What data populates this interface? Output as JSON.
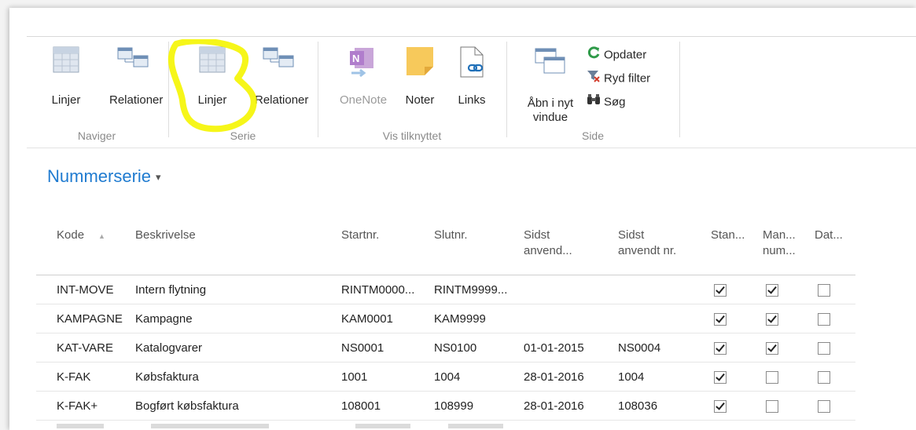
{
  "ribbon": {
    "groups": [
      {
        "label": "Naviger",
        "buttons": [
          "Linjer",
          "Relationer"
        ]
      },
      {
        "label": "Serie",
        "buttons": [
          "Linjer",
          "Relationer"
        ]
      },
      {
        "label": "Vis tilknyttet",
        "buttons": [
          "OneNote",
          "Noter",
          "Links"
        ]
      },
      {
        "label": "Side",
        "buttons": [
          "Åbn i nyt",
          "vindue"
        ],
        "small": [
          "Opdater",
          "Ryd filter",
          "Søg"
        ]
      }
    ]
  },
  "page": {
    "title": "Nummerserie"
  },
  "table": {
    "headers": [
      "Kode",
      "Beskrivelse",
      "Startnr.",
      "Slutnr.",
      "Sidst",
      "anvend...",
      "Sidst",
      "anvendt nr.",
      "Stan...",
      "Man...",
      "num...",
      "Dat..."
    ],
    "rows": [
      {
        "kode": "INT-MOVE",
        "beskrivelse": "Intern flytning",
        "start": "RINTM0000...",
        "slut": "RINTM9999...",
        "sidst_dato": "",
        "sidst_nr": "",
        "stan": true,
        "man": true,
        "dat": false
      },
      {
        "kode": "KAMPAGNE",
        "beskrivelse": "Kampagne",
        "start": "KAM0001",
        "slut": "KAM9999",
        "sidst_dato": "",
        "sidst_nr": "",
        "stan": true,
        "man": true,
        "dat": false
      },
      {
        "kode": "KAT-VARE",
        "beskrivelse": "Katalogvarer",
        "start": "NS0001",
        "slut": "NS0100",
        "sidst_dato": "01-01-2015",
        "sidst_nr": "NS0004",
        "stan": true,
        "man": true,
        "dat": false
      },
      {
        "kode": "K-FAK",
        "beskrivelse": "Købsfaktura",
        "start": "1001",
        "slut": "1004",
        "sidst_dato": "28-01-2016",
        "sidst_nr": "1004",
        "stan": true,
        "man": false,
        "dat": false
      },
      {
        "kode": "K-FAK+",
        "beskrivelse": "Bogført købsfaktura",
        "start": "108001",
        "slut": "108999",
        "sidst_dato": "28-01-2016",
        "sidst_nr": "108036",
        "stan": true,
        "man": false,
        "dat": false
      }
    ]
  },
  "colors": {
    "accent": "#1f7bd0",
    "highlight": "#f5f500"
  }
}
